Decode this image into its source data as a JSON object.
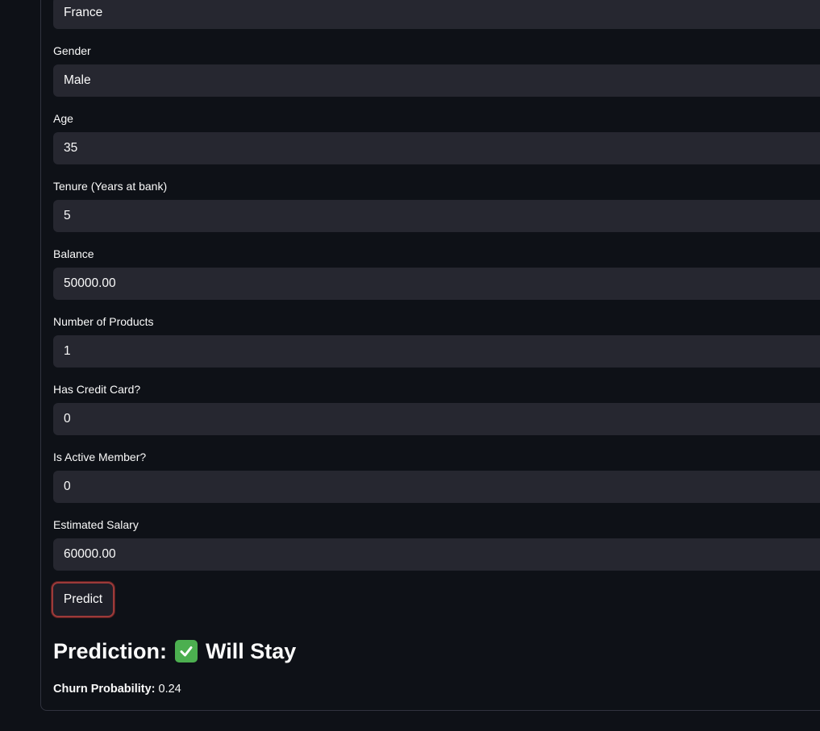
{
  "form": {
    "geography_value": "France",
    "fields": [
      {
        "label": "Gender",
        "value": "Male"
      },
      {
        "label": "Age",
        "value": "35"
      },
      {
        "label": "Tenure (Years at bank)",
        "value": "5"
      },
      {
        "label": "Balance",
        "value": "50000.00"
      },
      {
        "label": "Number of Products",
        "value": "1"
      },
      {
        "label": "Has Credit Card?",
        "value": "0"
      },
      {
        "label": "Is Active Member?",
        "value": "0"
      },
      {
        "label": "Estimated Salary",
        "value": "60000.00"
      }
    ],
    "predict_label": "Predict"
  },
  "result": {
    "prediction_prefix": "Prediction:",
    "prediction_icon": "check-mark-icon",
    "prediction_text": "Will Stay",
    "probability_label": "Churn Probability:",
    "probability_value": "0.24"
  },
  "colors": {
    "background": "#0e1117",
    "input_bg": "#262730",
    "button_border": "#9c3a3a",
    "check_green": "#4caf50"
  }
}
